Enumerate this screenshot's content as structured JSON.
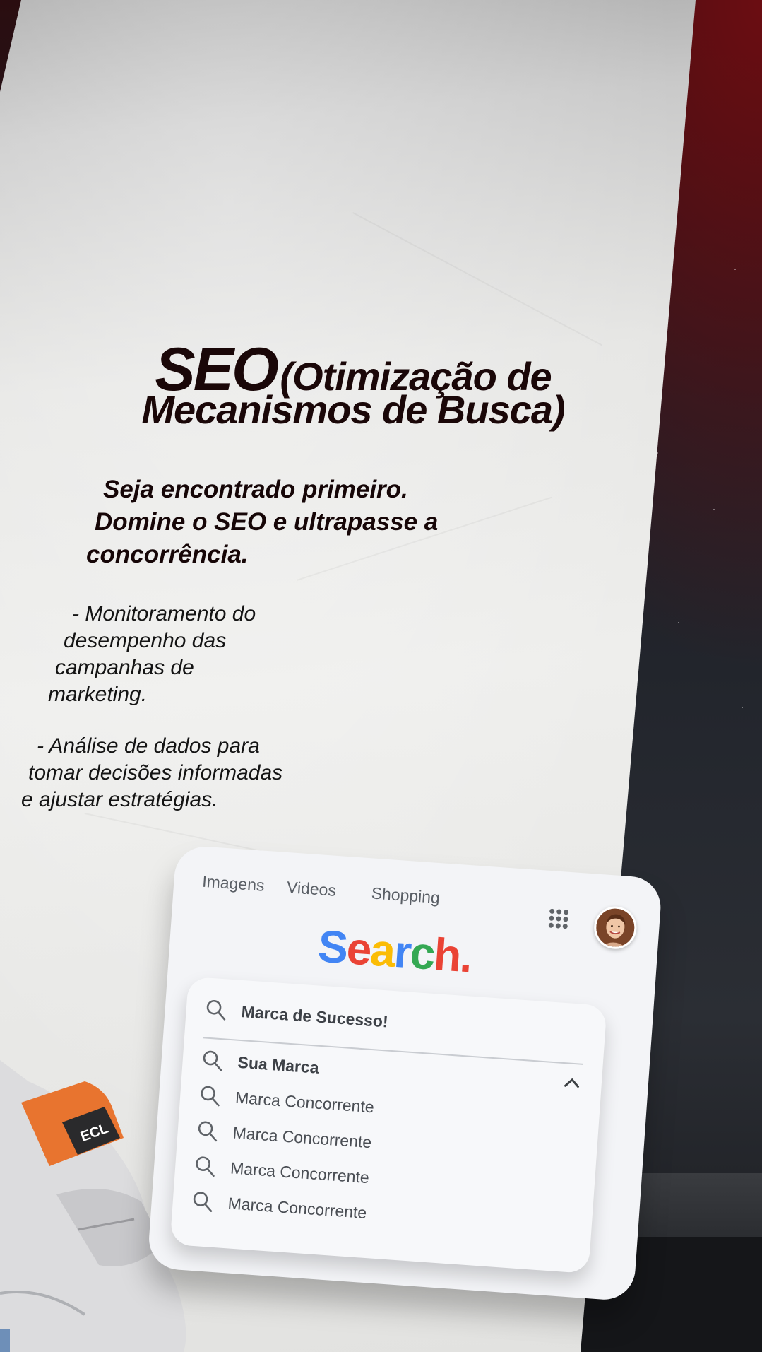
{
  "headline": {
    "seo": "SEO",
    "line1_rest": "(Otimização de",
    "line2": "Mecanismos de Busca)"
  },
  "subtitle": {
    "line1": "Seja encontrado primeiro.",
    "line2": "Domine o SEO e ultrapasse a",
    "line3": "concorrência."
  },
  "bullets": [
    {
      "lines": [
        "- Monitoramento do",
        "desempenho das",
        "campanhas de",
        "marketing."
      ]
    },
    {
      "lines": [
        "- Análise de dados para",
        "tomar decisões informadas",
        "e ajustar estratégias."
      ]
    }
  ],
  "search_card": {
    "tabs": [
      "Imagens",
      "Videos",
      "Shopping"
    ],
    "apps_icon": "grid-apps-icon",
    "avatar_icon": "user-avatar",
    "logo": {
      "letters": [
        "S",
        "e",
        "a",
        "r",
        "c",
        "h",
        "."
      ],
      "colors": [
        "#4285f4",
        "#ea4335",
        "#fbbc05",
        "#4285f4",
        "#34a853",
        "#ea4335",
        "#ea4335"
      ]
    },
    "query": "Marca de Sucesso!",
    "results": [
      "Sua Marca",
      "Marca Concorrente",
      "Marca Concorrente",
      "Marca Concorrente",
      "Marca Concorrente"
    ],
    "search_icon": "search-icon",
    "collapse_icon": "chevron-up-icon"
  },
  "badge_text": "ECL"
}
